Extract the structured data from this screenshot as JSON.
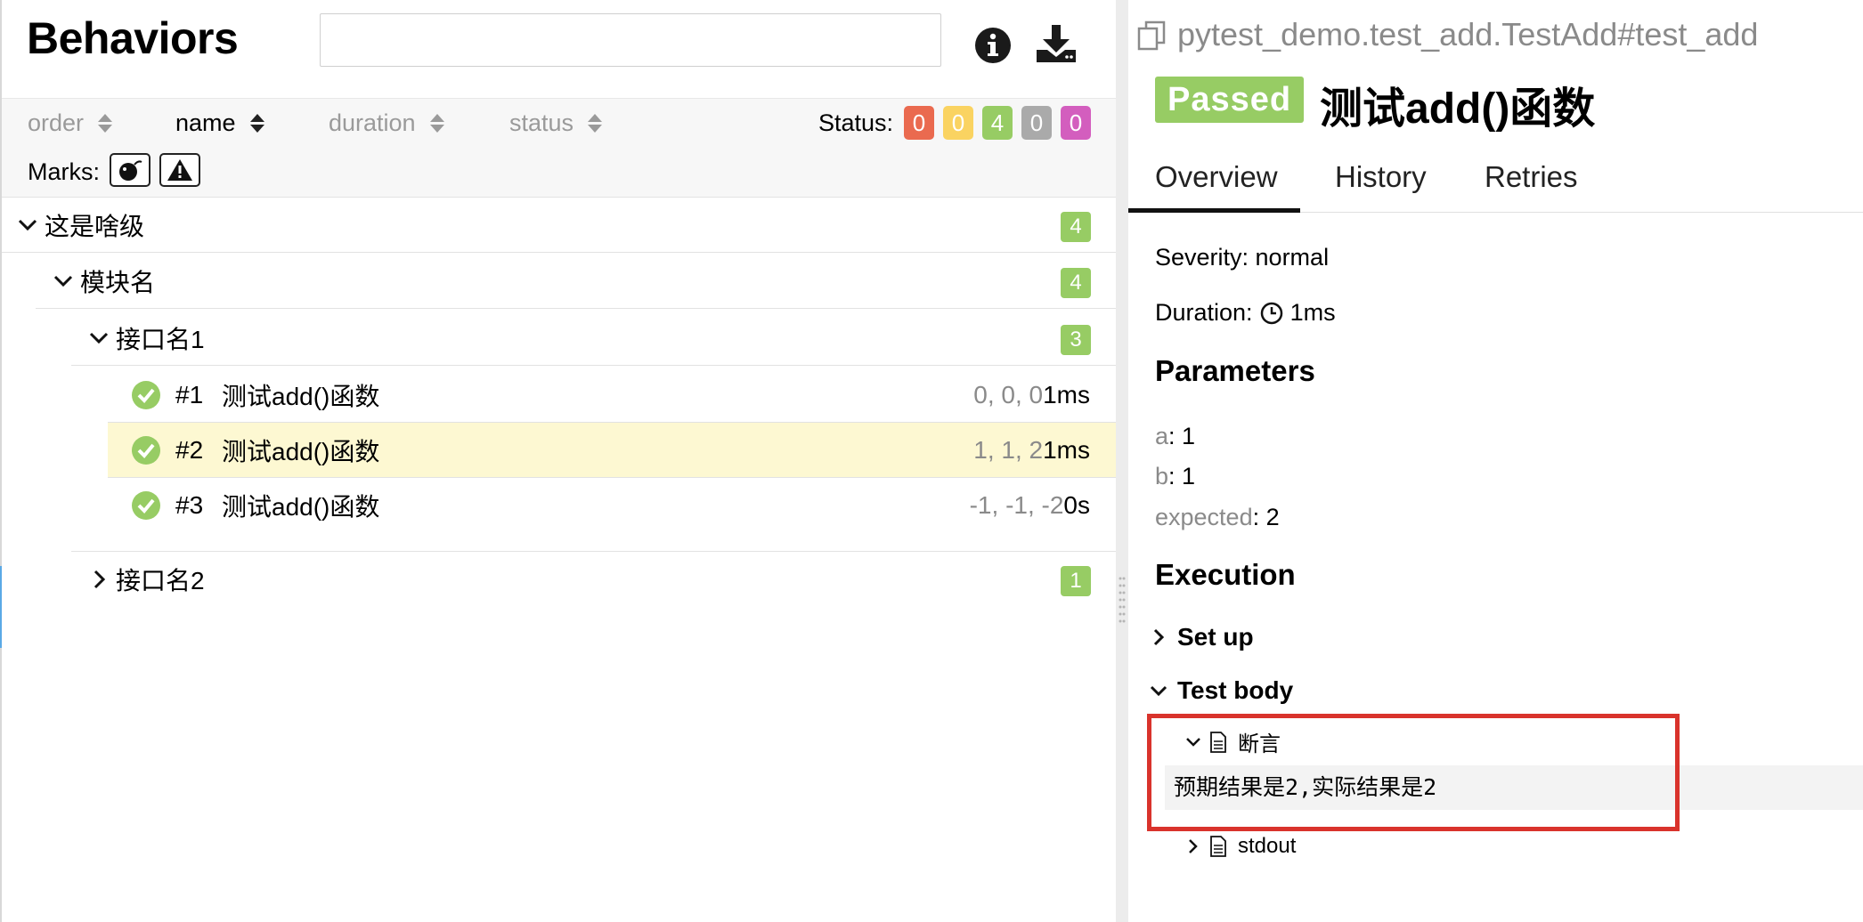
{
  "left": {
    "title": "Behaviors",
    "search": {
      "value": "",
      "placeholder": ""
    },
    "sort": {
      "order": "order",
      "name": "name",
      "duration": "duration",
      "status": "status"
    },
    "status_label": "Status:",
    "status_counts": [
      {
        "value": "0",
        "color": "#ea6a4f"
      },
      {
        "value": "0",
        "color": "#fad361"
      },
      {
        "value": "4",
        "color": "#97cc64"
      },
      {
        "value": "0",
        "color": "#aaaaaa"
      },
      {
        "value": "0",
        "color": "#d35ebe"
      }
    ],
    "marks_label": "Marks:",
    "marks": [
      "flaky-bomb-icon",
      "warning-icon"
    ],
    "tree": {
      "epic": {
        "label": "这是啥级",
        "count": "4"
      },
      "feature": {
        "label": "模块名",
        "count": "4"
      },
      "story1": {
        "label": "接口名1",
        "count": "3"
      },
      "story2": {
        "label": "接口名2",
        "count": "1"
      }
    },
    "cases": [
      {
        "num": "#1",
        "name": "测试add()函数",
        "params": "0, 0, 0",
        "duration": "1ms"
      },
      {
        "num": "#2",
        "name": "测试add()函数",
        "params": "1, 1, 2",
        "duration": "1ms"
      },
      {
        "num": "#3",
        "name": "测试add()函数",
        "params": "-1, -1, -2",
        "duration": "0s"
      }
    ]
  },
  "right": {
    "full_name": "pytest_demo.test_add.TestAdd#test_add",
    "status": "Passed",
    "title": "测试add()函数",
    "tabs": [
      "Overview",
      "History",
      "Retries"
    ],
    "severity": "Severity: normal",
    "duration_label": "Duration:",
    "duration_value": "1ms",
    "parameters_heading": "Parameters",
    "parameters": [
      {
        "key": "a",
        "value": ": 1"
      },
      {
        "key": "b",
        "value": ": 1"
      },
      {
        "key": "expected",
        "value": ": 2"
      }
    ],
    "execution_heading": "Execution",
    "setup": "Set up",
    "test_body": "Test body",
    "step_name": "断言",
    "message": "预期结果是2,实际结果是2",
    "stdout": "stdout"
  },
  "colors": {
    "passed": "#97cc64",
    "selected_row": "#fdf8d2",
    "highlight_box": "#d9332c"
  }
}
